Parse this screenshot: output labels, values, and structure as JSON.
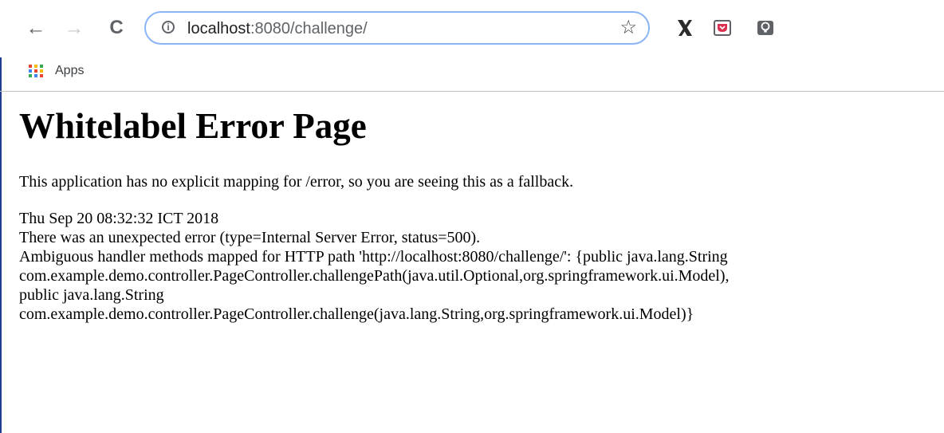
{
  "browser": {
    "back_icon": "←",
    "forward_icon": "→",
    "reload_icon": "C",
    "info_icon": "i",
    "url_host": "localhost",
    "url_path": ":8080/challenge/",
    "star_icon": "☆",
    "extensions": [
      "x-extension-icon",
      "pocket-icon",
      "lightbulb-icon"
    ],
    "colors": {
      "omnibox_border": "#8ab4f8",
      "pocket_red": "#d9304f",
      "rail": "#1f3c8f"
    }
  },
  "bookmarks": {
    "apps_label": "Apps"
  },
  "page": {
    "title": "Whitelabel Error Page",
    "description": "This application has no explicit mapping for /error, so you are seeing this as a fallback.",
    "details": [
      "Thu Sep 20 08:32:32 ICT 2018",
      "There was an unexpected error (type=Internal Server Error, status=500).",
      "Ambiguous handler methods mapped for HTTP path 'http://localhost:8080/challenge/': {public java.lang.String",
      "com.example.demo.controller.PageController.challengePath(java.util.Optional,org.springframework.ui.Model),",
      "public java.lang.String",
      "com.example.demo.controller.PageController.challenge(java.lang.String,org.springframework.ui.Model)}"
    ]
  }
}
